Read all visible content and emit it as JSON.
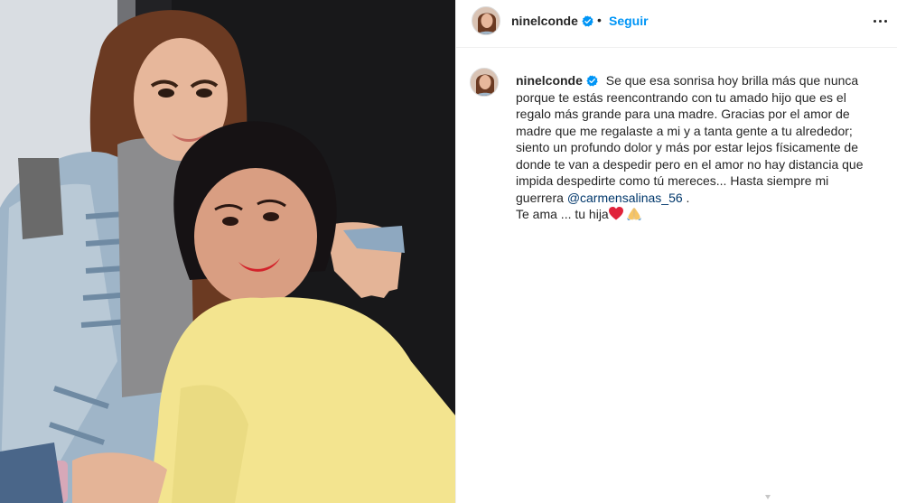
{
  "post": {
    "username": "ninelconde",
    "separator": "•",
    "follow_label": "Seguir",
    "more_icon": "more-horizontal-icon",
    "verified_icon": "verified-badge-icon"
  },
  "caption": {
    "username": "ninelconde",
    "text": "Se que esa sonrisa hoy brilla más que nunca porque te estás reencontrando con tu amado hijo que es el regalo más grande para una madre. Gracias por el amor de madre que me regalaste a mi y a tanta gente a tu alrededor; siento un profundo dolor y más por estar lejos físicamente de donde te van a despedir pero en el amor no hay distancia que impida despedirte como tú mereces... Hasta siempre mi guerrera",
    "mention": "@carmensalinas_56",
    "after_mention": " .",
    "closing": "Te ama ... tu hija",
    "emojis": [
      "red-heart-emoji",
      "folded-hands-emoji"
    ]
  },
  "colors": {
    "link_blue": "#0095f6",
    "mention_blue": "#00376b",
    "verified_blue": "#0095f6",
    "text": "#262626",
    "border": "#efefef"
  }
}
